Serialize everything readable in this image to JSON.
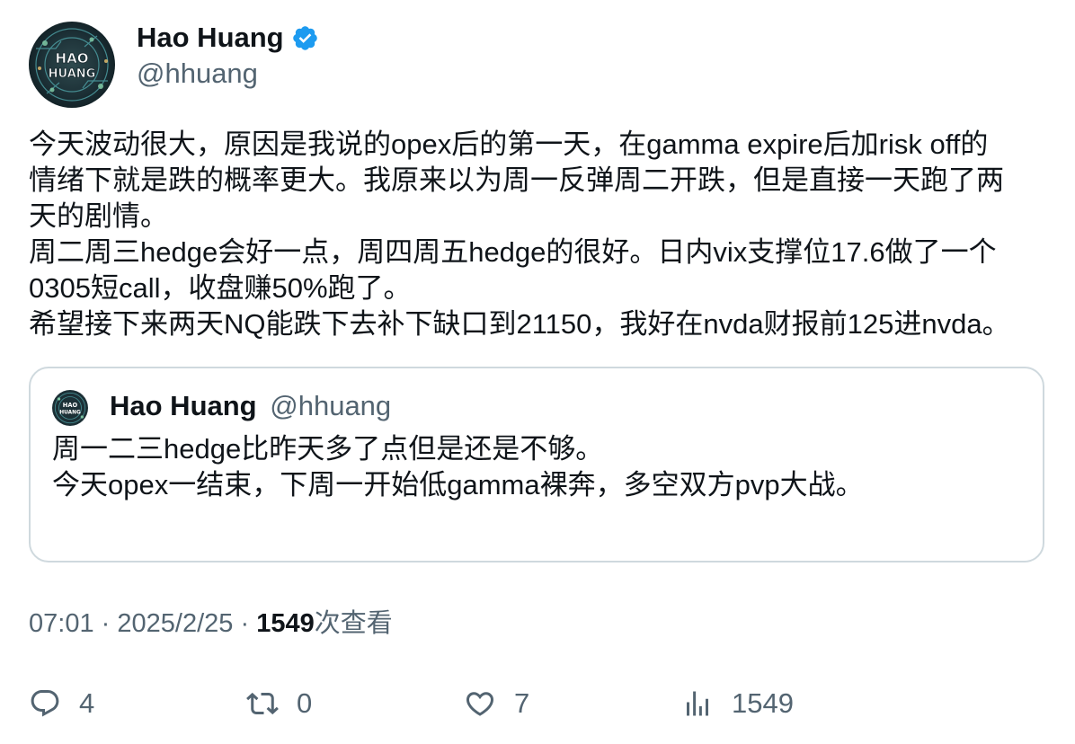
{
  "author": {
    "name": "Hao Huang",
    "handle": "@hhuang",
    "verified": true,
    "avatar_text": "HAO HUANG"
  },
  "tweet": {
    "lines": [
      "今天波动很大，原因是我说的opex后的第一天，在gamma expire后加risk off的",
      "情绪下就是跌的概率更大。我原来以为周一反弹周二开跌，但是直接一天跑了两",
      "天的剧情。",
      "周二周三hedge会好一点，周四周五hedge的很好。日内vix支撑位17.6做了一个",
      "0305短call，收盘赚50%跑了。",
      "希望接下来两天NQ能跌下去补下缺口到21150，我好在nvda财报前125进nvda。"
    ]
  },
  "quote": {
    "name": "Hao Huang",
    "handle": "@hhuang",
    "lines": [
      "周一二三hedge比昨天多了点但是还是不够。",
      "今天opex一结束，下周一开始低gamma裸奔，多空双方pvp大战。"
    ]
  },
  "meta": {
    "time": "07:01",
    "separator": "·",
    "date": "2025/2/25",
    "views": "1549",
    "views_label": "次查看"
  },
  "actions": {
    "replies": "4",
    "retweets": "0",
    "likes": "7",
    "views": "1549"
  },
  "colors": {
    "text": "#0f1419",
    "secondary": "#536471",
    "verified": "#1d9bf0",
    "border": "#cfd9de"
  },
  "icons": {
    "reply": "reply-icon",
    "retweet": "retweet-icon",
    "like": "heart-icon",
    "views": "analytics-icon",
    "verified": "verified-badge-icon"
  }
}
